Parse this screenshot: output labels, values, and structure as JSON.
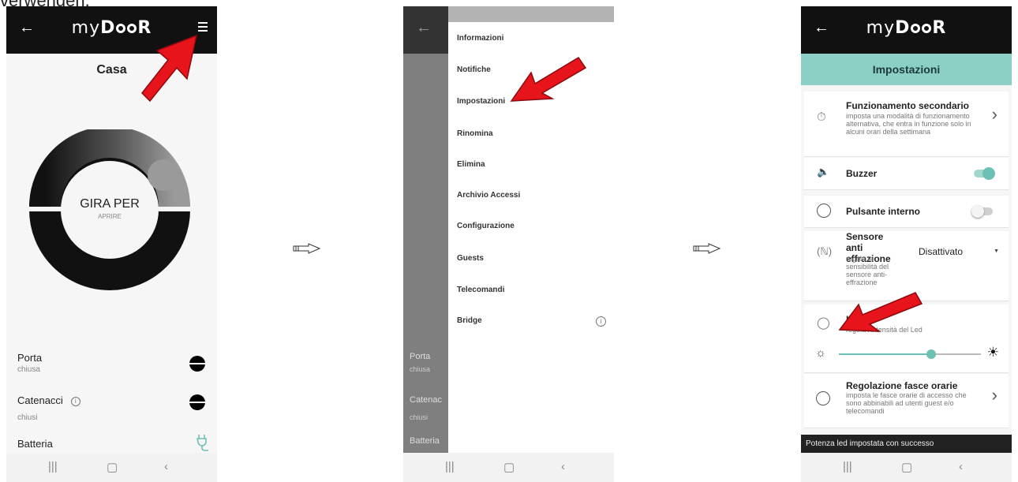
{
  "header_text": "verwenden.",
  "app": {
    "logo": "myDOOR"
  },
  "screen1": {
    "title": "Casa",
    "dial_main": "GIRA PER",
    "dial_sub": "APRIRE",
    "status": [
      {
        "label": "Porta",
        "value": "chiusa"
      },
      {
        "label": "Catenacci",
        "value": "chiusi"
      },
      {
        "label": "Batteria"
      }
    ]
  },
  "screen2": {
    "menu": [
      "Informazioni",
      "Notifiche",
      "Impostazioni",
      "Rinomina",
      "Elimina",
      "Archivio Accessi",
      "Configurazione",
      "Guests",
      "Telecomandi",
      "Bridge"
    ],
    "behind": {
      "porta": "Porta",
      "porta_value": "chiusa",
      "catenacci": "Catenac",
      "catenacci_value": "chiusi",
      "batteria": "Batteria"
    }
  },
  "screen3": {
    "title": "Impostazioni",
    "secondary": {
      "title": "Funzionamento secondario",
      "desc": "imposta una modalità di funzionamento alternativa, che entra in funzione solo in alcuni orari della settimana"
    },
    "buzzer": {
      "label": "Buzzer",
      "on": true
    },
    "internal_button": {
      "label": "Pulsante interno",
      "on": false
    },
    "tamper": {
      "title": "Sensore anti effrazione",
      "desc": "regola la sensibilità del sensore anti-effrazione",
      "value": "Disattivato"
    },
    "led": {
      "title": "Led",
      "desc": "regola l'intensità del Led",
      "level": 0.65
    },
    "schedule": {
      "title": "Regolazione fasce orarie",
      "desc": "imposta le fasce orarie di accesso che sono abbinabili ad utenti guest e/o telecomandi"
    },
    "snackbar": "Potenza led impostata con successo"
  },
  "colors": {
    "accent": "#6cc0b4",
    "pointer": "#e8141b",
    "topbar": "#111111",
    "teal_header": "#8ccfc4"
  },
  "icons": [
    "back-arrow-icon",
    "hamburger-menu-icon",
    "info-icon",
    "lock-icon",
    "plug-icon",
    "timer-icon",
    "speaker-icon",
    "circle-icon",
    "vibration-icon",
    "lightbulb-icon",
    "sun-icon",
    "clock-icon",
    "chevron-right-icon",
    "dropdown-arrow-icon",
    "recent-apps-icon",
    "home-icon",
    "back-nav-icon"
  ]
}
